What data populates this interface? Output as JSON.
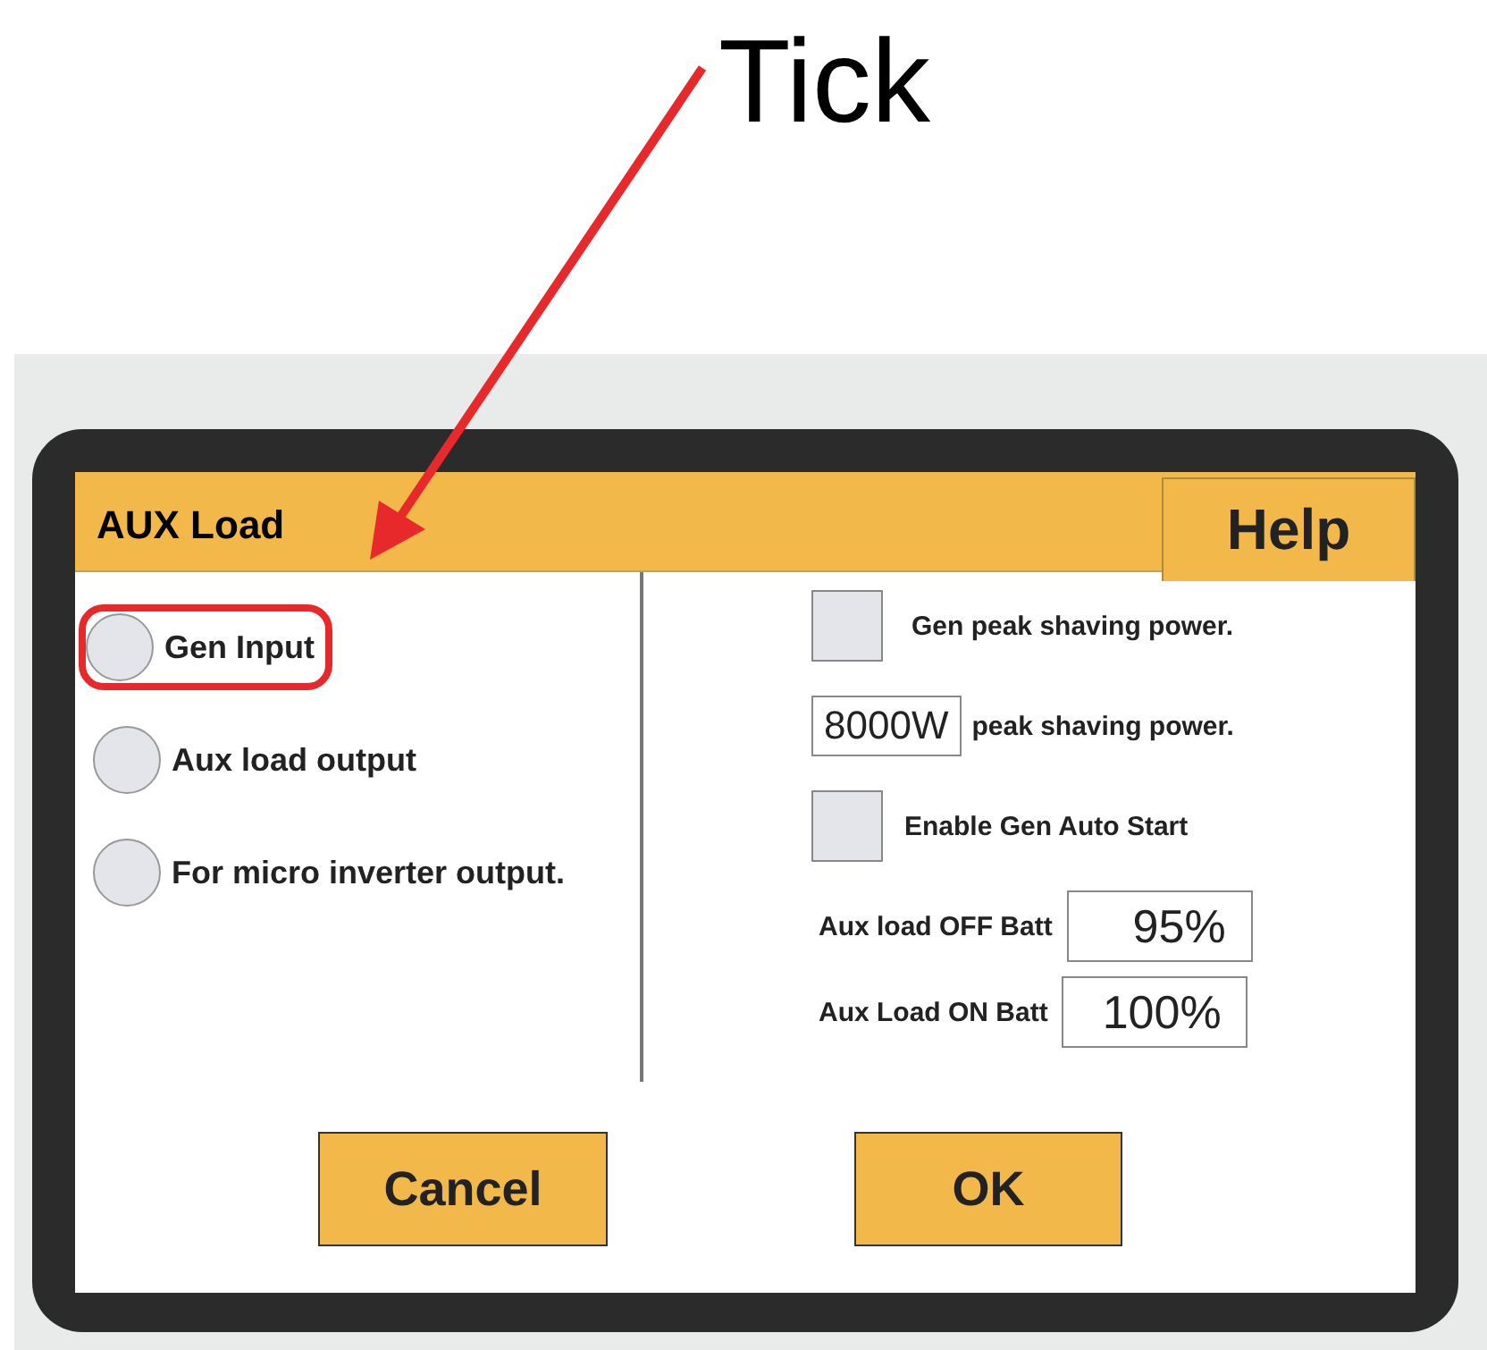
{
  "annotation": {
    "label": "Tick"
  },
  "dialog": {
    "title": "AUX Load",
    "help": "Help",
    "options": [
      {
        "label": "Gen Input",
        "selected": false,
        "highlighted": true
      },
      {
        "label": "Aux load output",
        "selected": false,
        "highlighted": false
      },
      {
        "label": "For micro inverter output.",
        "selected": false,
        "highlighted": false
      }
    ],
    "settings": [
      {
        "kind": "checkbox",
        "label": "Gen peak shaving power.",
        "checked": false
      },
      {
        "kind": "value",
        "value": "8000W",
        "label": "peak shaving power."
      },
      {
        "kind": "checkbox",
        "label": "Enable Gen Auto Start",
        "checked": false
      },
      {
        "kind": "batt",
        "label": "Aux load OFF Batt",
        "value": "95%"
      },
      {
        "kind": "batt",
        "label": "Aux Load ON Batt",
        "value": "100%"
      }
    ],
    "buttons": [
      "Cancel",
      "OK"
    ]
  }
}
